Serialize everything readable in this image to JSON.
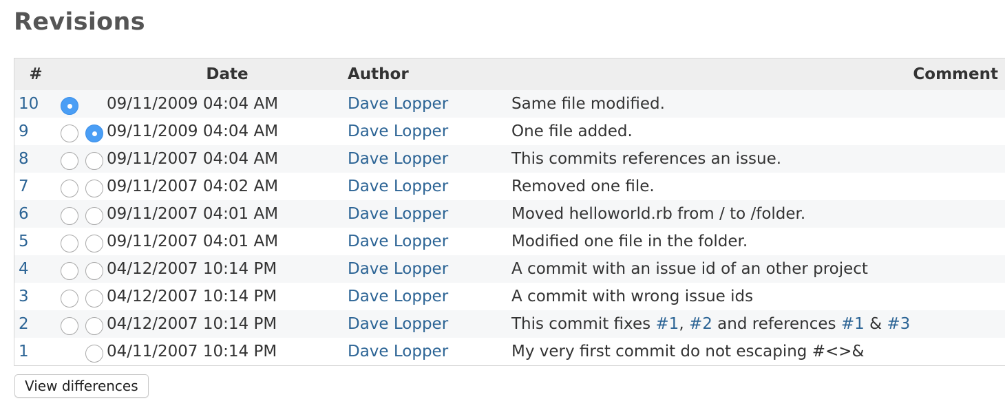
{
  "page": {
    "title": "Revisions"
  },
  "table": {
    "headers": {
      "id": "#",
      "date": "Date",
      "author": "Author",
      "comment": "Comment"
    },
    "rows": [
      {
        "id": "10",
        "r1": "checked",
        "r2": "none",
        "date": "09/11/2009 04:04 AM",
        "author": "Dave Lopper",
        "comment": [
          {
            "text": "Same file modified."
          }
        ]
      },
      {
        "id": "9",
        "r1": "unchecked",
        "r2": "checked",
        "date": "09/11/2009 04:04 AM",
        "author": "Dave Lopper",
        "comment": [
          {
            "text": "One file added."
          }
        ]
      },
      {
        "id": "8",
        "r1": "unchecked",
        "r2": "unchecked",
        "date": "09/11/2007 04:04 AM",
        "author": "Dave Lopper",
        "comment": [
          {
            "text": "This commits references an issue."
          }
        ]
      },
      {
        "id": "7",
        "r1": "unchecked",
        "r2": "unchecked",
        "date": "09/11/2007 04:02 AM",
        "author": "Dave Lopper",
        "comment": [
          {
            "text": "Removed one file."
          }
        ]
      },
      {
        "id": "6",
        "r1": "unchecked",
        "r2": "unchecked",
        "date": "09/11/2007 04:01 AM",
        "author": "Dave Lopper",
        "comment": [
          {
            "text": "Moved helloworld.rb from / to /folder."
          }
        ]
      },
      {
        "id": "5",
        "r1": "unchecked",
        "r2": "unchecked",
        "date": "09/11/2007 04:01 AM",
        "author": "Dave Lopper",
        "comment": [
          {
            "text": "Modified one file in the folder."
          }
        ]
      },
      {
        "id": "4",
        "r1": "unchecked",
        "r2": "unchecked",
        "date": "04/12/2007 10:14 PM",
        "author": "Dave Lopper",
        "comment": [
          {
            "text": "A commit with an issue id of an other project"
          }
        ]
      },
      {
        "id": "3",
        "r1": "unchecked",
        "r2": "unchecked",
        "date": "04/12/2007 10:14 PM",
        "author": "Dave Lopper",
        "comment": [
          {
            "text": "A commit with wrong issue ids"
          }
        ]
      },
      {
        "id": "2",
        "r1": "unchecked",
        "r2": "unchecked",
        "date": "04/12/2007 10:14 PM",
        "author": "Dave Lopper",
        "comment": [
          {
            "text": "This commit fixes "
          },
          {
            "text": "#1",
            "link": true
          },
          {
            "text": ", "
          },
          {
            "text": "#2",
            "link": true
          },
          {
            "text": " and references "
          },
          {
            "text": "#1",
            "link": true
          },
          {
            "text": " & "
          },
          {
            "text": "#3",
            "link": true
          }
        ]
      },
      {
        "id": "1",
        "r1": "none",
        "r2": "unchecked",
        "date": "04/11/2007 10:14 PM",
        "author": "Dave Lopper",
        "comment": [
          {
            "text": "My very first commit do not escaping #<>&"
          }
        ]
      }
    ]
  },
  "actions": {
    "view_differences": "View differences"
  },
  "colors": {
    "link": "#2c6495",
    "radio_checked": "#4a9ef5",
    "header_bg": "#eeeeee"
  }
}
